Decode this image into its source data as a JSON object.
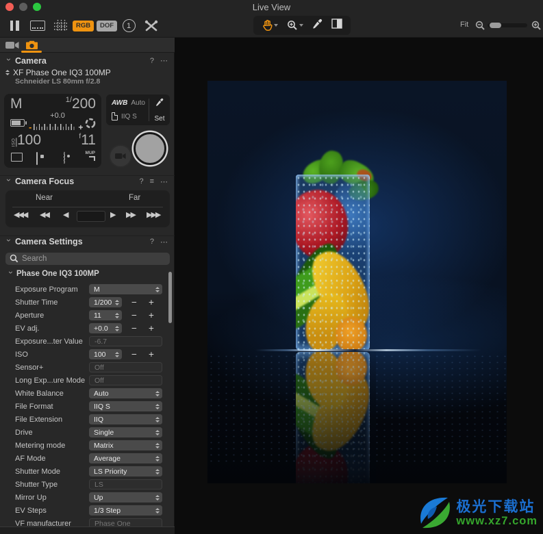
{
  "window": {
    "title": "Live View"
  },
  "toolbar": {
    "rgb_label": "RGB",
    "dof_label": "DOF",
    "overlay_number": "1",
    "fit_label": "Fit"
  },
  "sidebar": {
    "camera_panel": {
      "title": "Camera",
      "help_icon": "?",
      "more_icon": "⋯",
      "camera_name": "XF Phase One IQ3 100MP",
      "lens_name": "Schneider LS 80mm f/2.8",
      "lcd": {
        "mode": "M",
        "shutter_prefix": "1/",
        "shutter_value": "200",
        "ev_value": "+0.0",
        "scale_minus": "-",
        "scale_plus": "+",
        "iso_label": "ISO",
        "iso_value": "100",
        "aperture_prefix": "f",
        "aperture_value": "11",
        "mup_label": "MUP"
      },
      "wb": {
        "awb_label": "AWB",
        "awb_value": "Auto",
        "format_value": "IIQ S",
        "set_label": "Set"
      }
    },
    "focus_panel": {
      "title": "Camera Focus",
      "help_icon": "?",
      "menu_icon": "≡",
      "more_icon": "⋯",
      "near_label": "Near",
      "far_label": "Far",
      "buttons": {
        "big_near": "◀◀◀",
        "mid_near": "◀◀",
        "small_near": "◀",
        "small_far": "▶",
        "mid_far": "▶▶",
        "big_far": "▶▶▶"
      },
      "input_value": ""
    },
    "settings_panel": {
      "title": "Camera Settings",
      "help_icon": "?",
      "more_icon": "⋯",
      "search_placeholder": "Search",
      "group_label": "Phase One IQ3 100MP",
      "minus_label": "−",
      "plus_label": "+",
      "rows": [
        {
          "label": "Exposure Program",
          "value": "M",
          "type": "dropdown"
        },
        {
          "label": "Shutter Time",
          "value": "1/200",
          "type": "stepper"
        },
        {
          "label": "Aperture",
          "value": "11",
          "type": "stepper"
        },
        {
          "label": "EV adj.",
          "value": "+0.0",
          "type": "stepper"
        },
        {
          "label": "Exposure...ter Value",
          "value": "-6.7",
          "type": "disabled"
        },
        {
          "label": "ISO",
          "value": "100",
          "type": "stepper"
        },
        {
          "label": "Sensor+",
          "value": "Off",
          "type": "disabled"
        },
        {
          "label": "Long Exp...ure Mode",
          "value": "Off",
          "type": "disabled"
        },
        {
          "label": "White Balance",
          "value": "Auto",
          "type": "dropdown"
        },
        {
          "label": "File Format",
          "value": "IIQ S",
          "type": "dropdown"
        },
        {
          "label": "File Extension",
          "value": "IIQ",
          "type": "dropdown"
        },
        {
          "label": "Drive",
          "value": "Single",
          "type": "dropdown"
        },
        {
          "label": "Metering mode",
          "value": "Matrix",
          "type": "dropdown"
        },
        {
          "label": "AF Mode",
          "value": "Average",
          "type": "dropdown"
        },
        {
          "label": "Shutter Mode",
          "value": "LS Priority",
          "type": "dropdown"
        },
        {
          "label": "Shutter Type",
          "value": "LS",
          "type": "disabled"
        },
        {
          "label": "Mirror Up",
          "value": "Up",
          "type": "dropdown"
        },
        {
          "label": "EV Steps",
          "value": "1/3 Step",
          "type": "dropdown"
        },
        {
          "label": "VF manufacturer",
          "value": "Phase One",
          "type": "disabled"
        }
      ]
    }
  },
  "viewer": {
    "watermark": {
      "line1": "极光下载站",
      "line2": "www.xz7.com"
    }
  },
  "colors": {
    "accent_orange": "#ef9310",
    "watermark_blue": "#1b6fd0",
    "watermark_green": "#35a52c",
    "lcd_background": "#1c1c1c",
    "sidebar_background": "#282828"
  }
}
